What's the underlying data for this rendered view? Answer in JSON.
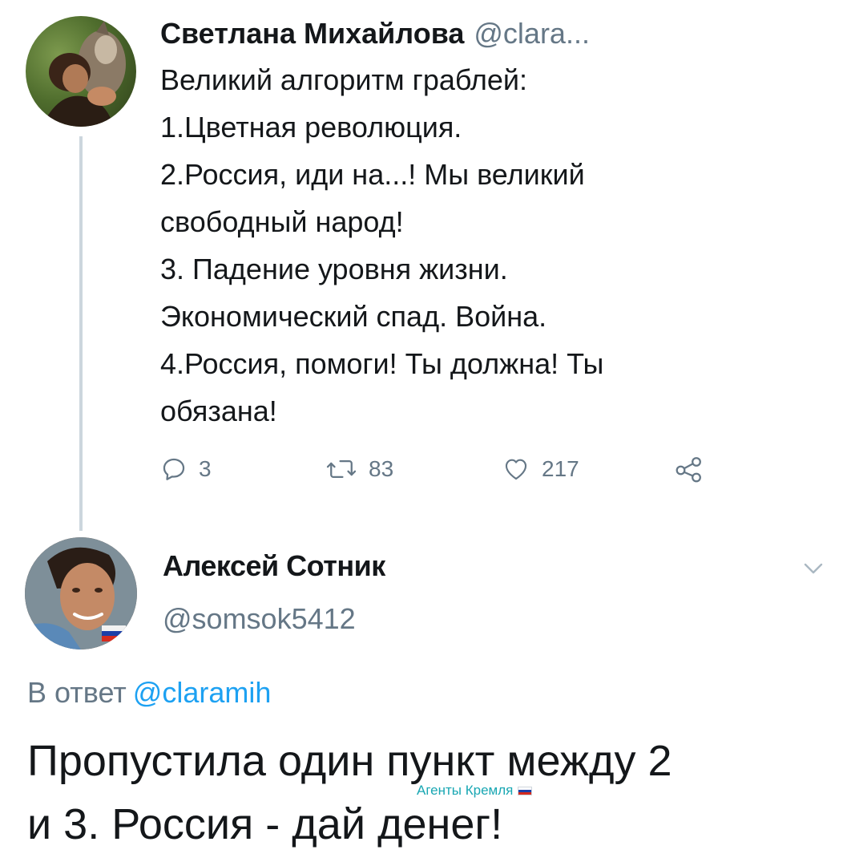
{
  "tweet1": {
    "author_name": "Светлана Михайлова",
    "author_handle": "@clara...",
    "avatar_icon": "woman-with-dog-avatar",
    "body_lines": [
      "Великий алгоритм граблей:",
      "1.Цветная революция.",
      "2.Россия, иди на...! Мы великий",
      "свободный народ!",
      "3. Падение уровня жизни.",
      "Экономический спад. Война.",
      "4.Россия, помоги! Ты должна! Ты",
      "обязана!"
    ],
    "actions": {
      "reply_icon": "reply-icon",
      "reply_count": "3",
      "retweet_icon": "retweet-icon",
      "retweet_count": "83",
      "like_icon": "heart-icon",
      "like_count": "217",
      "share_icon": "share-icon"
    }
  },
  "tweet2": {
    "author_name": "Алексей Сотник",
    "author_handle": "@somsok5412",
    "avatar_icon": "man-portrait-avatar",
    "menu_icon": "chevron-down-icon",
    "reply_to_label": "В ответ",
    "reply_to_mention": "@claramih",
    "body_lines": [
      "Пропустила один пункт между 2",
      "и 3.  Россия  - дай денег!"
    ]
  },
  "watermark": {
    "text": "Агенты Кремля",
    "flag_icon": "russia-flag-icon"
  },
  "colors": {
    "text_primary": "#14171a",
    "text_secondary": "#657786",
    "link": "#1da1f2",
    "thread_line": "#ccd6dd",
    "watermark": "#19a7b3"
  }
}
